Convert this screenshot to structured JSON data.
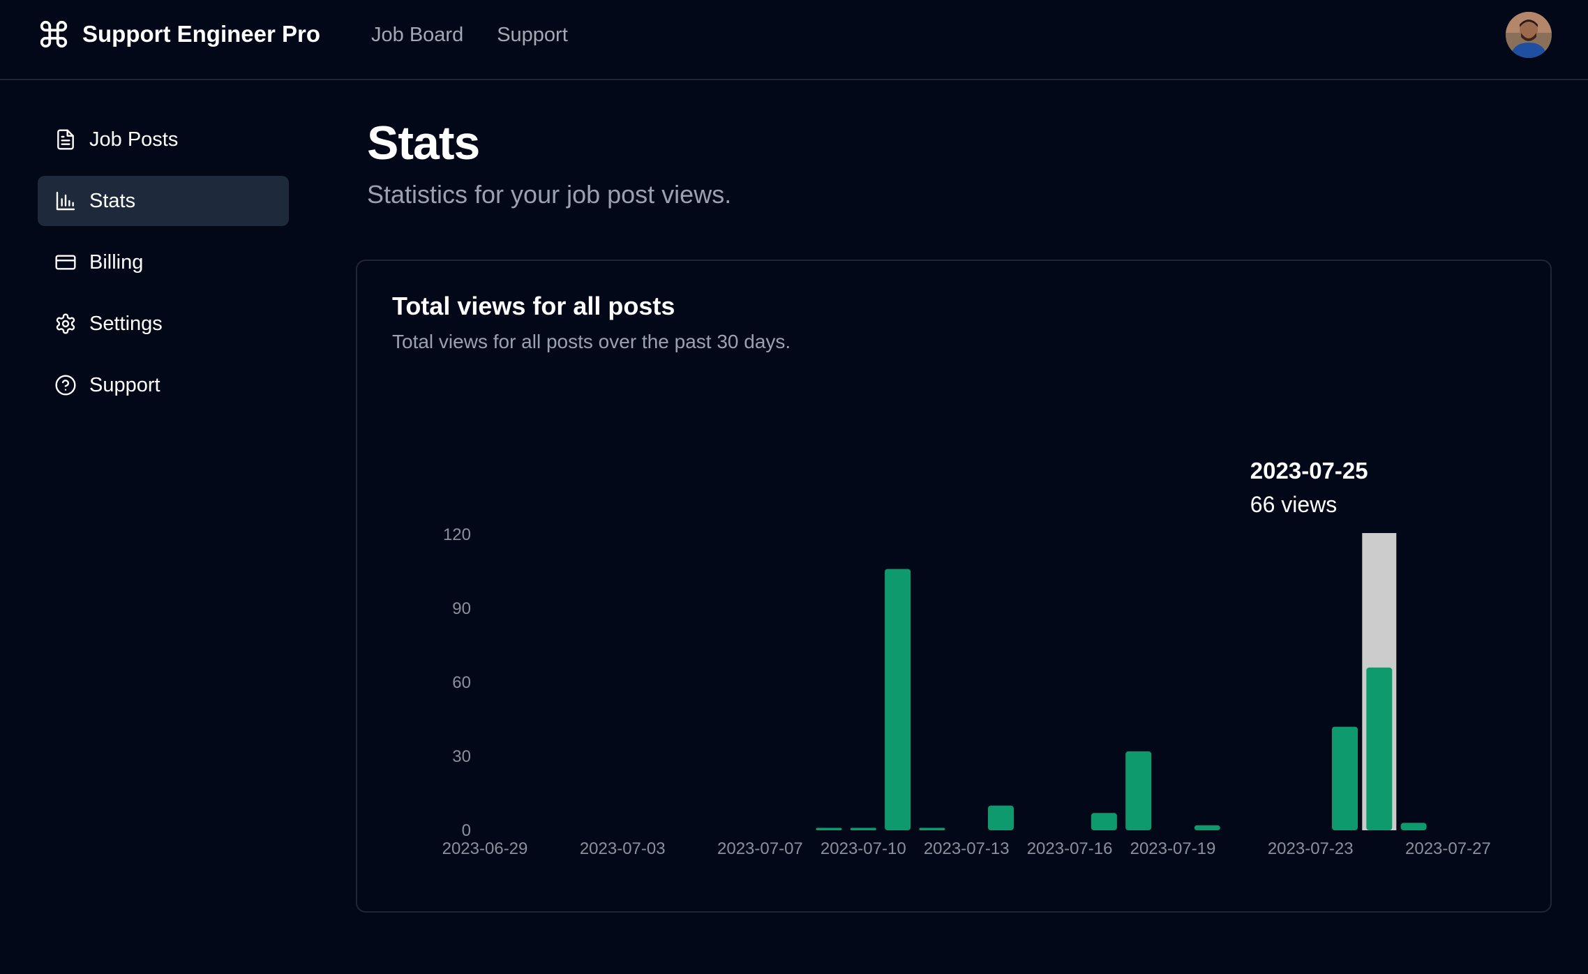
{
  "app": {
    "name": "Support Engineer Pro"
  },
  "topnav": [
    {
      "label": "Job Board"
    },
    {
      "label": "Support"
    }
  ],
  "sidebar": {
    "items": [
      {
        "label": "Job Posts",
        "icon": "document-icon"
      },
      {
        "label": "Stats",
        "icon": "bar-chart-icon",
        "active": true
      },
      {
        "label": "Billing",
        "icon": "credit-card-icon"
      },
      {
        "label": "Settings",
        "icon": "gear-icon"
      },
      {
        "label": "Support",
        "icon": "help-circle-icon"
      }
    ]
  },
  "page": {
    "title": "Stats",
    "subtitle": "Statistics for your job post views."
  },
  "card": {
    "title": "Total views for all posts",
    "subtitle": "Total views for all posts over the past 30 days."
  },
  "colors": {
    "bar": "#0f9a6e",
    "highlight": "#cccccc",
    "background": "#030818"
  },
  "chart_data": {
    "type": "bar",
    "categories": [
      "2023-06-29",
      "2023-06-30",
      "2023-07-01",
      "2023-07-02",
      "2023-07-03",
      "2023-07-04",
      "2023-07-05",
      "2023-07-06",
      "2023-07-07",
      "2023-07-08",
      "2023-07-09",
      "2023-07-10",
      "2023-07-11",
      "2023-07-12",
      "2023-07-13",
      "2023-07-14",
      "2023-07-15",
      "2023-07-16",
      "2023-07-17",
      "2023-07-18",
      "2023-07-19",
      "2023-07-20",
      "2023-07-21",
      "2023-07-22",
      "2023-07-23",
      "2023-07-24",
      "2023-07-25",
      "2023-07-26",
      "2023-07-27"
    ],
    "values": [
      0,
      0,
      0,
      0,
      0,
      0,
      0,
      0,
      0,
      0,
      1,
      1,
      106,
      1,
      0,
      10,
      0,
      0,
      7,
      32,
      0,
      2,
      0,
      0,
      0,
      42,
      66,
      3,
      0
    ],
    "x_tick_labels": [
      "2023-06-29",
      "2023-07-03",
      "2023-07-07",
      "2023-07-10",
      "2023-07-13",
      "2023-07-16",
      "2023-07-19",
      "2023-07-23",
      "2023-07-27"
    ],
    "ylim": [
      0,
      120
    ],
    "y_ticks": [
      0,
      30,
      60,
      90,
      120
    ],
    "grid": false,
    "tooltip": {
      "date": "2023-07-25",
      "text": "66 views"
    }
  }
}
